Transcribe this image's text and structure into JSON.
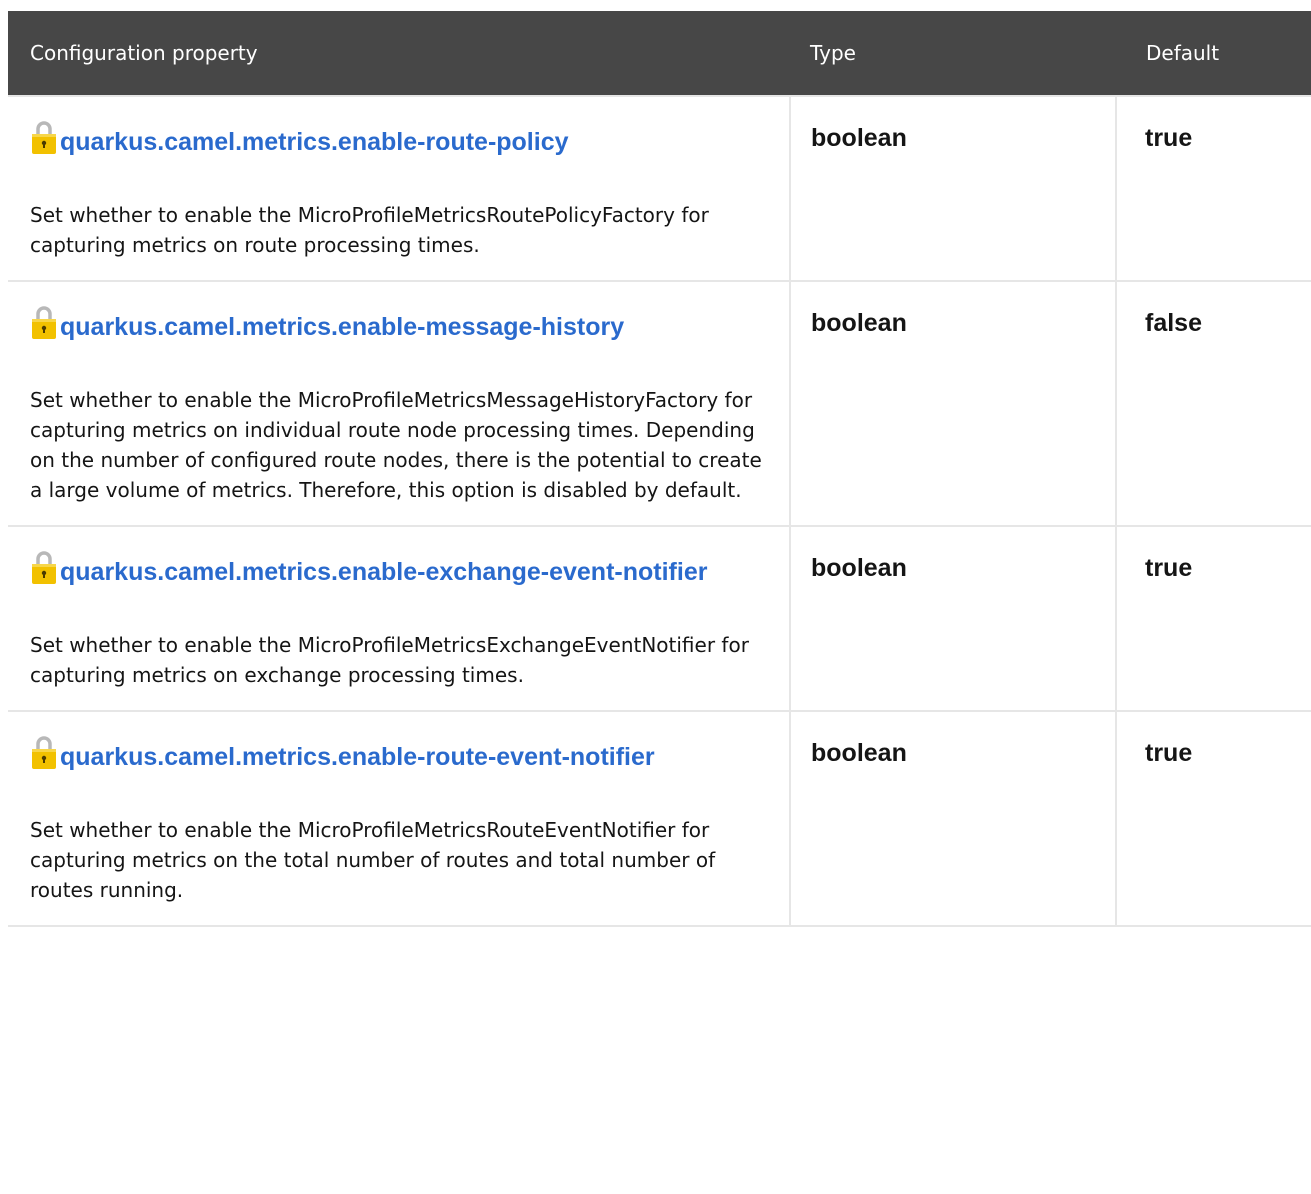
{
  "table": {
    "headers": {
      "property": "Configuration property",
      "type": "Type",
      "default": "Default"
    },
    "rows": [
      {
        "name": "quarkus.camel.metrics.enable-route-policy",
        "description": "Set whether to enable the MicroProfileMetricsRoutePolicyFactory for capturing metrics on route processing times.",
        "type": "boolean",
        "default": "true",
        "lock_icon": "lock-icon"
      },
      {
        "name": "quarkus.camel.metrics.enable-message-history",
        "description": "Set whether to enable the MicroProfileMetricsMessageHistoryFactory for capturing metrics on individual route node processing times. Depending on the number of configured route nodes, there is the potential to create a large volume of metrics. Therefore, this option is disabled by default.",
        "type": "boolean",
        "default": "false",
        "lock_icon": "lock-icon"
      },
      {
        "name": "quarkus.camel.metrics.enable-exchange-event-notifier",
        "description": "Set whether to enable the MicroProfileMetricsExchangeEventNotifier for capturing metrics on exchange processing times.",
        "type": "boolean",
        "default": "true",
        "lock_icon": "lock-icon"
      },
      {
        "name": "quarkus.camel.metrics.enable-route-event-notifier",
        "description": "Set whether to enable the MicroProfileMetricsRouteEventNotifier for capturing metrics on the total number of routes and total number of routes running.",
        "type": "boolean",
        "default": "true",
        "lock_icon": "lock-icon"
      }
    ]
  },
  "colors": {
    "header_bg": "#474747",
    "header_text": "#ffffff",
    "link": "#2a6acd",
    "border": "#e6e6e6",
    "lock_body": "#f2c100",
    "lock_shackle": "#b8b8b8"
  }
}
